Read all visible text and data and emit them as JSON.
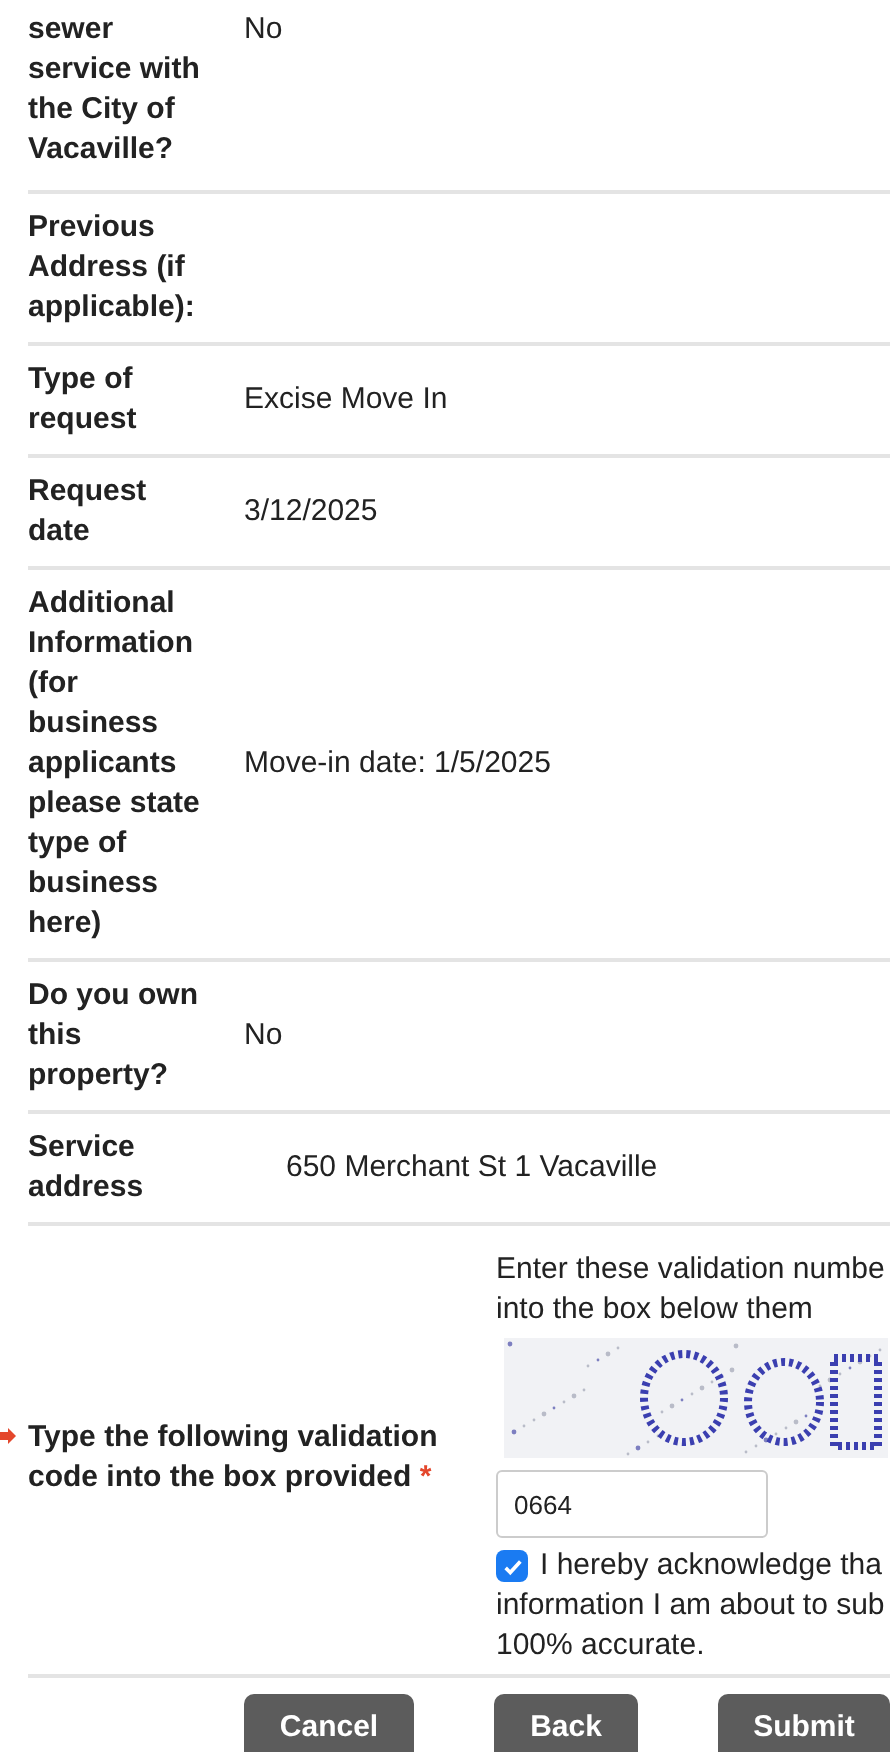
{
  "rows": [
    {
      "label": "sewer service with the City of Vacaville?",
      "value": "No"
    },
    {
      "label": "Previous Address (if applicable):"
    },
    {
      "label": "Type of request",
      "value": "Excise Move In"
    },
    {
      "label": "Request date",
      "value": "3/12/2025"
    },
    {
      "label": "Additional Information (for business applicants please state type of business here)",
      "value": "Move-in date: 1/5/2025"
    },
    {
      "label": "Do you own this property?",
      "value": "No"
    },
    {
      "label": "Service address",
      "value": "650 Merchant St 1 Vacaville",
      "kind": "indented"
    }
  ],
  "validation": {
    "label": "Type the following validation code into the box provided",
    "required_mark": "*",
    "instructions": [
      "Enter these validation numbe",
      "into the box below them"
    ],
    "captcha": {
      "kind": "picture"
    },
    "value": "0664",
    "acknowledge": {
      "checked": true,
      "lines": [
        "I hereby acknowledge tha",
        "information I am about to sub",
        "100% accurate."
      ]
    }
  },
  "buttons": [
    "Cancel",
    "Back",
    "Submit"
  ]
}
